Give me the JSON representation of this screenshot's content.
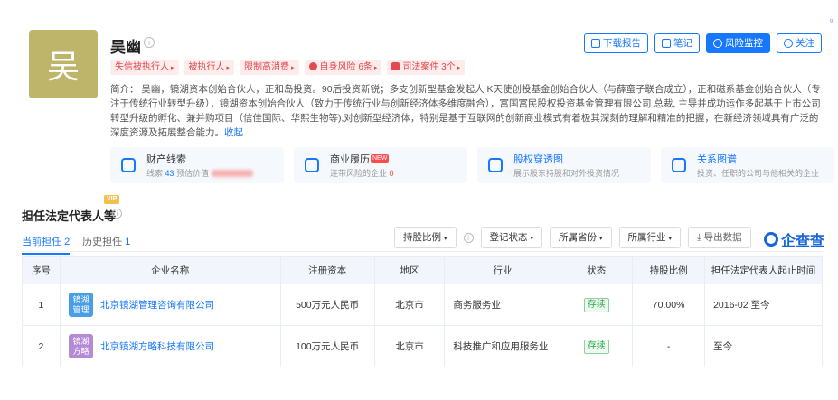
{
  "profile": {
    "avatar_char": "吴",
    "name": "吴幽",
    "info_icon": "i",
    "tags": [
      {
        "label": "失信被执行人",
        "icon": "",
        "icon_shape": ""
      },
      {
        "label": "被执行人",
        "icon": "",
        "icon_shape": ""
      },
      {
        "label": "限制高消费",
        "icon": "",
        "icon_shape": ""
      },
      {
        "label": "自身风险 6条",
        "icon": "shield-icon",
        "icon_shape": "round"
      },
      {
        "label": "司法案件 3个",
        "icon": "gavel-icon",
        "icon_shape": "square"
      }
    ],
    "tag_arrow": "▸",
    "bio": "简介：  吴幽，镜湖资本创始合伙人，正和岛投资。90后投资新锐；多支创新型基金发起人 K天使创投基金创始合伙人（与薛蛮子联合成立），正和磁系基金创始合伙人（专注于传统行业转型升级），镜湖资本创始合伙人（致力于传统行业与创新经济体多维度融合），富国富民股权投资基金管理有限公司 总裁, 主导并成功运作多起基于上市公司转型升级的孵化、兼并购项目（信佳国际、华熙生物等),对创新型经济体，特别是基于互联网的创新商业模式有着极其深刻的理解和精准的把握，在新经济领域具有广泛的深度资源及拓展整合能力。",
    "bio_more": "收起"
  },
  "actions": [
    {
      "label": "下载报告",
      "style": "outline",
      "icon": "document-icon"
    },
    {
      "label": "笔记",
      "style": "outline",
      "icon": "edit-icon"
    },
    {
      "label": "风险监控",
      "style": "solid",
      "icon": "monitor-icon"
    },
    {
      "label": "关注",
      "style": "outline",
      "icon": "heart-icon"
    }
  ],
  "corner_mark": "ᵍ",
  "cards": [
    {
      "title": "财产线索",
      "title_style": "",
      "prefix": "线索 ",
      "num": "43",
      "num_style": "",
      "suffix": " 预估价值 ",
      "blurred": true,
      "new_badge": false,
      "icon": "property-clue-icon"
    },
    {
      "title": "商业履历",
      "title_style": "",
      "prefix": "连带风险的企业 ",
      "num": "0",
      "num_style": "red",
      "suffix": "",
      "blurred": false,
      "new_badge": true,
      "badge": "NEW",
      "icon": "briefcase-icon"
    },
    {
      "title": "股权穿透图",
      "title_style": "blue",
      "prefix": "展示股东持股和对外投资情况",
      "num": "",
      "num_style": "",
      "suffix": "",
      "blurred": false,
      "new_badge": false,
      "icon": "equity-chart-icon"
    },
    {
      "title": "关系图谱",
      "title_style": "blue",
      "prefix": "投资、任职的公司与他相关的企业",
      "num": "",
      "num_style": "",
      "suffix": "",
      "blurred": false,
      "new_badge": false,
      "icon": "share-graph-icon"
    }
  ],
  "section": {
    "vip": "VIP",
    "title": "担任法定代表人等",
    "info_icon": "i",
    "tabs": [
      {
        "label": "当前担任",
        "count": "2",
        "active": true
      },
      {
        "label": "历史担任",
        "count": "1",
        "active": false
      }
    ]
  },
  "filters": [
    {
      "label": "持股比例"
    },
    {
      "label": "登记状态"
    },
    {
      "label": "所属省份"
    },
    {
      "label": "所属行业"
    }
  ],
  "caret": "▾",
  "export_label": "导出数据",
  "export_icon": "⤓",
  "brand": "企查查",
  "table": {
    "headers": [
      "序号",
      "企业名称",
      "注册资本",
      "地区",
      "行业",
      "状态",
      "持股比例",
      "担任法定代表人起止时间"
    ],
    "rows": [
      {
        "index": "1",
        "logo": "镜湖 管理",
        "logo_color": "#4a9ee8",
        "name": "北京镜湖管理咨询有限公司",
        "capital": "500万元人民币",
        "region": "北京市",
        "industry": "商务服务业",
        "status": "存续",
        "share": "70.00%",
        "period": "2016-02 至今"
      },
      {
        "index": "2",
        "logo": "镜湖 方略",
        "logo_color": "#b48ad6",
        "name": "北京镜湖方略科技有限公司",
        "capital": "100万元人民币",
        "region": "北京市",
        "industry": "科技推广和应用服务业",
        "status": "存续",
        "share": "-",
        "period": "至今"
      }
    ]
  }
}
